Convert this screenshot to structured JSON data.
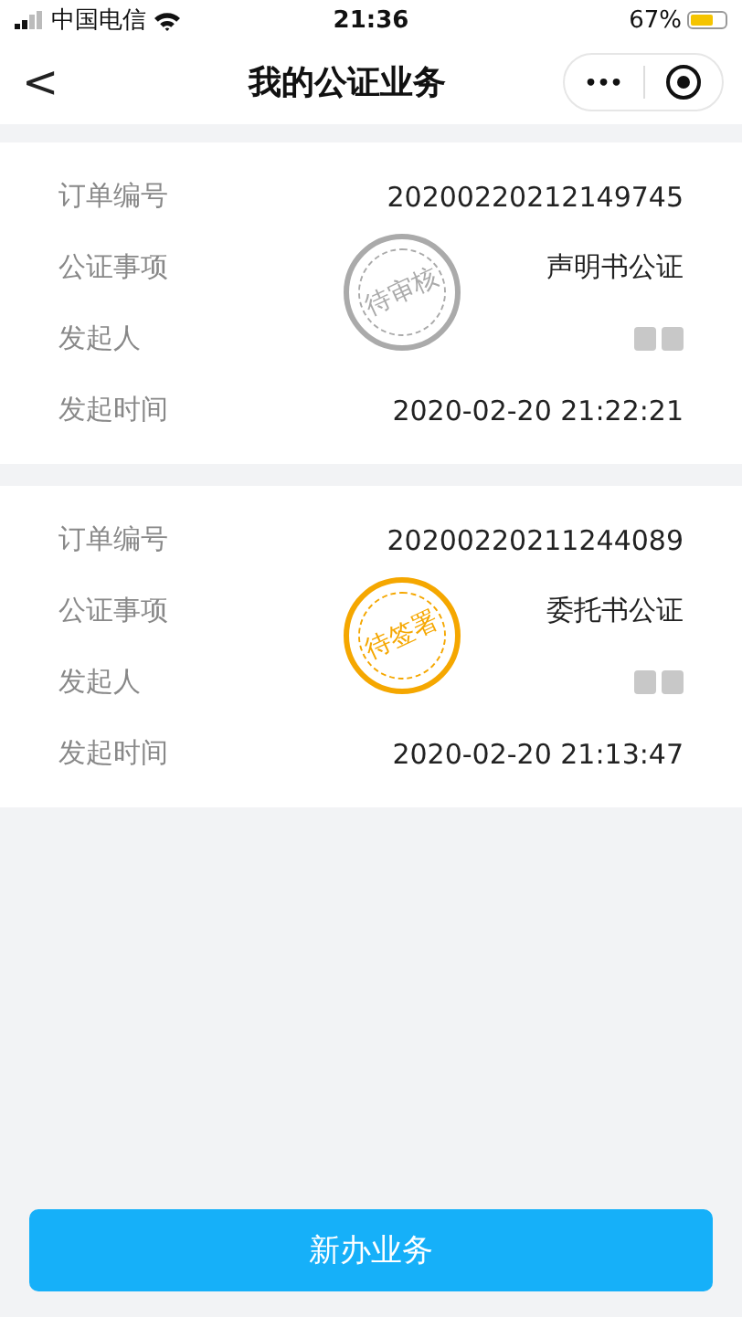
{
  "status_bar": {
    "carrier": "中国电信",
    "time": "21:36",
    "battery": "67%"
  },
  "nav": {
    "title": "我的公证业务",
    "back": "<",
    "more": "•••"
  },
  "orders": [
    {
      "fields": [
        {
          "label": "订单编号",
          "value": "20200220212149745",
          "redacted": false
        },
        {
          "label": "公证事项",
          "value": "声明书公证",
          "redacted": false
        },
        {
          "label": "发起人",
          "redacted": true
        },
        {
          "label": "发起时间",
          "value": "2020-02-20 21:22:21",
          "redacted": false
        }
      ],
      "stamp": {
        "text": "待审核",
        "color": "#aaaaaa"
      }
    },
    {
      "fields": [
        {
          "label": "订单编号",
          "value": "20200220211244089",
          "redacted": false
        },
        {
          "label": "公证事项",
          "value": "委托书公证",
          "redacted": false
        },
        {
          "label": "发起人",
          "redacted": true
        },
        {
          "label": "发起时间",
          "value": "2020-02-20 21:13:47",
          "redacted": false
        }
      ],
      "stamp": {
        "text": "待签署",
        "color": "#f5a700"
      }
    }
  ],
  "new_button": "新办业务"
}
